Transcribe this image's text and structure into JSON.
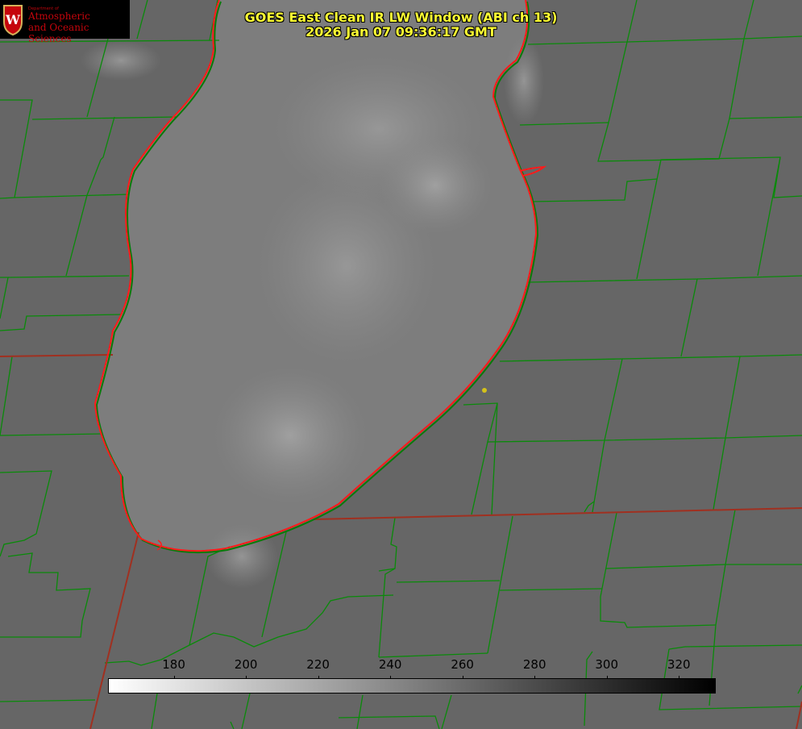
{
  "title": {
    "line1": "GOES East Clean IR LW Window (ABI ch 13)",
    "line2": "2026 Jan 07 09:36:17 GMT"
  },
  "logo": {
    "dept": "Department of",
    "line1": "Atmospheric",
    "line2": "and Oceanic Sciences",
    "seal_letter": "W"
  },
  "colorbar": {
    "ticks": [
      "180",
      "200",
      "220",
      "240",
      "260",
      "280",
      "300",
      "320"
    ],
    "min_value": 162,
    "max_value": 330,
    "colors": {
      "low": "#ffffff",
      "high": "#000000"
    }
  },
  "map_colors": {
    "background": "#666666",
    "county_lines": "#0a8a0a",
    "lake_outline": "#ff1a1a",
    "state_lines": "#ff2a1a",
    "marker": "#d4c21a"
  }
}
